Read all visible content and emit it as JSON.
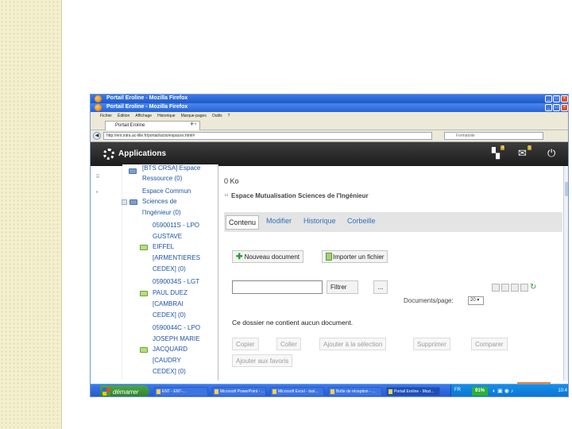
{
  "browser": {
    "window_title": "Portail Eroline - Mozilla Firefox",
    "menu": [
      "Fichier",
      "Édition",
      "Affichage",
      "Historique",
      "Marque-pages",
      "Outils",
      "?"
    ],
    "tab_label": "Portail Eroline",
    "url": "http://ent.intra.ac-lille.fr/portail/actio/espaces.html#",
    "search_placeholder": "Formatoile"
  },
  "appbar": {
    "title": "Applications",
    "notif_badge": "4",
    "mail_badge": "1"
  },
  "tree": {
    "items": [
      {
        "label": "[BTS CRSA] Espace",
        "folder": "blue"
      },
      {
        "label": "Ressource (0)",
        "folder": "none"
      },
      {
        "label": "Espace Commun",
        "folder": "none"
      },
      {
        "label": "Sciences de",
        "folder": "blue"
      },
      {
        "label": "l'Ingénieur (0)",
        "folder": "none"
      },
      {
        "label": "0590011S - LPO",
        "folder": "none"
      },
      {
        "label": "GUSTAVE",
        "folder": "none"
      },
      {
        "label": "EIFFEL",
        "folder": "green"
      },
      {
        "label": "[ARMENTIERES",
        "folder": "none"
      },
      {
        "label": "CEDEX] (0)",
        "folder": "none"
      },
      {
        "label": "0590034S - LGT",
        "folder": "none"
      },
      {
        "label": "PAUL DUEZ",
        "folder": "green"
      },
      {
        "label": "[CAMBRAI",
        "folder": "none"
      },
      {
        "label": "CEDEX] (0)",
        "folder": "none"
      },
      {
        "label": "0590044C - LPO",
        "folder": "none"
      },
      {
        "label": "JOSEPH MARIE",
        "folder": "none"
      },
      {
        "label": "JACQUARD",
        "folder": "green"
      },
      {
        "label": "[CAUDRY",
        "folder": "none"
      },
      {
        "label": "CEDEX] (0)",
        "folder": "none"
      }
    ]
  },
  "main": {
    "size": "0 Ko",
    "space_title": "Espace Mutualisation Sciences de l'Ingénieur",
    "tabs": [
      "Contenu",
      "Modifier",
      "Historique",
      "Corbeille"
    ],
    "new_doc": "Nouveau document",
    "import_file": "Importer un fichier",
    "filter_btn": "Filtrer",
    "dots_btn": "...",
    "perpage_label": "Documents/page:",
    "perpage_value": "20",
    "empty_message": "Ce dossier ne contient aucun document.",
    "actions": [
      "Copier",
      "Coller",
      "Ajouter à la sélection",
      "Supprimer",
      "Comparer"
    ],
    "favorites": "Ajouter aux favoris"
  },
  "taskbar": {
    "start": "démarrer",
    "tasks": [
      "ENT - ENT-...",
      "Microsoft PowerPoint - ...",
      "Microsoft Excel - tool...",
      "Boîte de réception - ...",
      "Portail Eroline - Mozi..."
    ],
    "lang": "FR",
    "battery": "91%",
    "clock": "10:4"
  }
}
